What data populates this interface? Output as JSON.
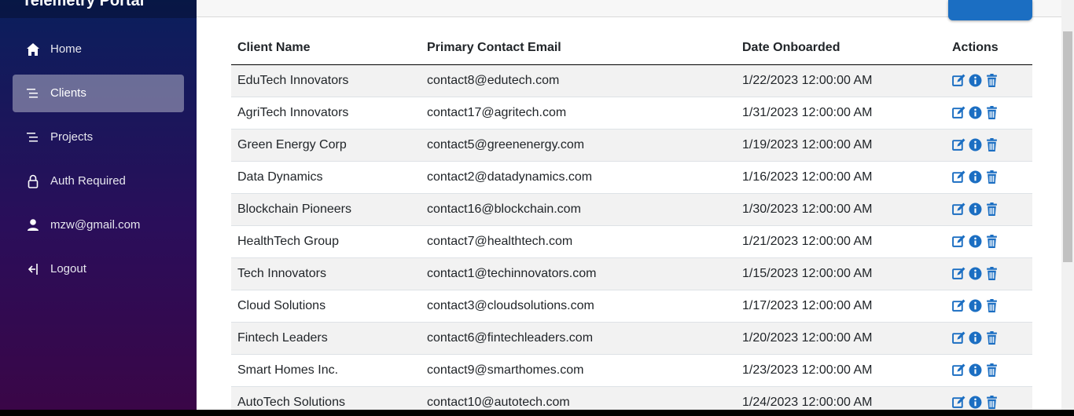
{
  "app": {
    "title": "Telemetry Portal"
  },
  "sidebar": {
    "items": [
      {
        "label": "Home",
        "icon": "home-icon"
      },
      {
        "label": "Clients",
        "icon": "list-icon",
        "active": true
      },
      {
        "label": "Projects",
        "icon": "list-icon"
      },
      {
        "label": "Auth Required",
        "icon": "lock-icon"
      },
      {
        "label": "mzw@gmail.com",
        "icon": "user-icon"
      },
      {
        "label": "Logout",
        "icon": "logout-icon"
      }
    ]
  },
  "table": {
    "headers": [
      "Client Name",
      "Primary Contact Email",
      "Date Onboarded",
      "Actions"
    ],
    "rows": [
      {
        "name": "EduTech Innovators",
        "email": "contact8@edutech.com",
        "date": "1/22/2023 12:00:00 AM"
      },
      {
        "name": "AgriTech Innovators",
        "email": "contact17@agritech.com",
        "date": "1/31/2023 12:00:00 AM"
      },
      {
        "name": "Green Energy Corp",
        "email": "contact5@greenenergy.com",
        "date": "1/19/2023 12:00:00 AM"
      },
      {
        "name": "Data Dynamics",
        "email": "contact2@datadynamics.com",
        "date": "1/16/2023 12:00:00 AM"
      },
      {
        "name": "Blockchain Pioneers",
        "email": "contact16@blockchain.com",
        "date": "1/30/2023 12:00:00 AM"
      },
      {
        "name": "HealthTech Group",
        "email": "contact7@healthtech.com",
        "date": "1/21/2023 12:00:00 AM"
      },
      {
        "name": "Tech Innovators",
        "email": "contact1@techinnovators.com",
        "date": "1/15/2023 12:00:00 AM"
      },
      {
        "name": "Cloud Solutions",
        "email": "contact3@cloudsolutions.com",
        "date": "1/17/2023 12:00:00 AM"
      },
      {
        "name": "Fintech Leaders",
        "email": "contact6@fintechleaders.com",
        "date": "1/20/2023 12:00:00 AM"
      },
      {
        "name": "Smart Homes Inc.",
        "email": "contact9@smarthomes.com",
        "date": "1/23/2023 12:00:00 AM"
      },
      {
        "name": "AutoTech Solutions",
        "email": "contact10@autotech.com",
        "date": "1/24/2023 12:00:00 AM"
      }
    ],
    "action_icons": [
      "edit-icon",
      "info-icon",
      "trash-icon"
    ]
  },
  "colors": {
    "accent": "#1b6ec2",
    "sidebar_top": "#0a1f5c",
    "sidebar_bottom": "#3a0647"
  }
}
